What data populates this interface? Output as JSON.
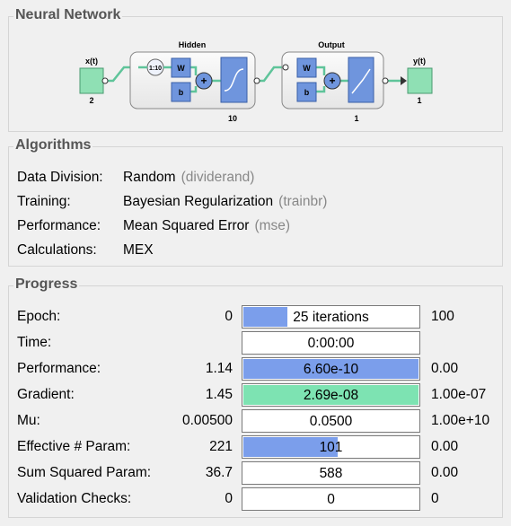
{
  "network": {
    "title": "Neural Network",
    "input": {
      "label": "x(t)",
      "size": "2"
    },
    "hidden": {
      "label": "Hidden",
      "delay": "1:10",
      "weight": "W",
      "bias": "b",
      "sum": "+",
      "neurons": "10"
    },
    "output_layer": {
      "label": "Output",
      "weight": "W",
      "bias": "b",
      "sum": "+",
      "neurons": "1"
    },
    "output": {
      "label": "y(t)",
      "size": "1"
    },
    "colors": {
      "node": "#8fe0b4",
      "block": "#6f95dd",
      "layer_bg": "#f2f2f2"
    }
  },
  "algorithms": {
    "title": "Algorithms",
    "rows": [
      {
        "label": "Data Division:",
        "value": "Random",
        "code": "(dividerand)"
      },
      {
        "label": "Training:",
        "value": "Bayesian Regularization",
        "code": "(trainbr)"
      },
      {
        "label": "Performance:",
        "value": "Mean Squared Error",
        "code": "(mse)"
      },
      {
        "label": "Calculations:",
        "value": "MEX",
        "code": ""
      }
    ]
  },
  "progress": {
    "title": "Progress",
    "rows": [
      {
        "label": "Epoch:",
        "start": "0",
        "current": "25 iterations",
        "end": "100",
        "fill": 0.25,
        "color": "#7b9eeb"
      },
      {
        "label": "Time:",
        "start": "",
        "current": "0:00:00",
        "end": "",
        "fill": 0,
        "color": "#7b9eeb"
      },
      {
        "label": "Performance:",
        "start": "1.14",
        "current": "6.60e-10",
        "end": "0.00",
        "fill": 1.0,
        "color": "#7b9eeb"
      },
      {
        "label": "Gradient:",
        "start": "1.45",
        "current": "2.69e-08",
        "end": "1.00e-07",
        "fill": 1.0,
        "color": "#7de3b2"
      },
      {
        "label": "Mu:",
        "start": "0.00500",
        "current": "0.0500",
        "end": "1.00e+10",
        "fill": 0,
        "color": "#7b9eeb"
      },
      {
        "label": "Effective # Param:",
        "start": "221",
        "current": "101",
        "end": "0.00",
        "fill": 0.54,
        "color": "#7b9eeb"
      },
      {
        "label": "Sum Squared Param:",
        "start": "36.7",
        "current": "588",
        "end": "0.00",
        "fill": 0,
        "color": "#7b9eeb"
      },
      {
        "label": "Validation Checks:",
        "start": "0",
        "current": "0",
        "end": "0",
        "fill": 0,
        "color": "#7b9eeb"
      }
    ]
  }
}
